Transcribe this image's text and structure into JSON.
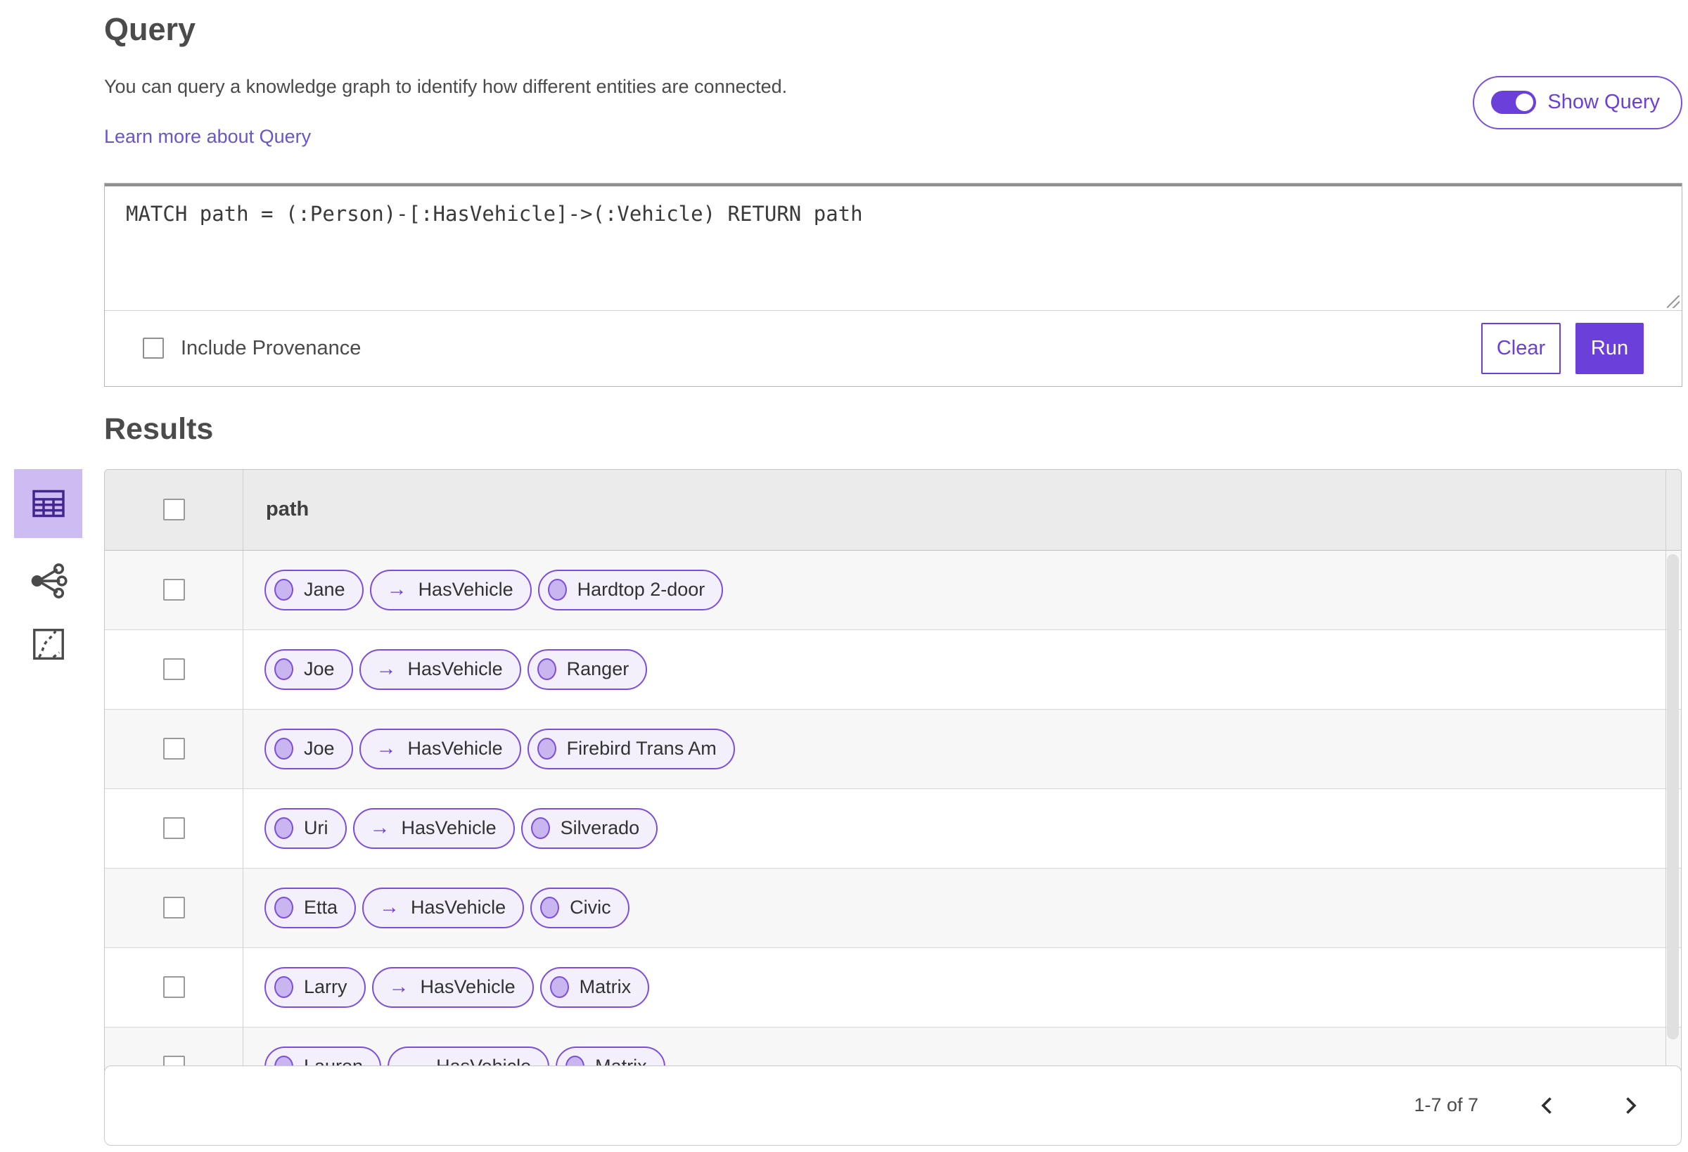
{
  "query_section": {
    "title": "Query",
    "description": "You can query a knowledge graph to identify how different entities are connected.",
    "learn_more_label": "Learn more about Query",
    "show_query": {
      "label": "Show Query",
      "state": "on"
    },
    "query_text": "MATCH path = (:Person)-[:HasVehicle]->(:Vehicle) RETURN path",
    "include_provenance": {
      "label": "Include Provenance",
      "checked": false
    },
    "clear_label": "Clear",
    "run_label": "Run"
  },
  "results_section": {
    "title": "Results",
    "views": [
      {
        "icon": "table-view-icon",
        "selected": true
      },
      {
        "icon": "link-chart-view-icon",
        "selected": false
      },
      {
        "icon": "map-view-icon",
        "selected": false
      }
    ],
    "table": {
      "columns": [
        "path"
      ],
      "select_all_checked": false,
      "rows": [
        {
          "path": [
            {
              "type": "node",
              "label": "Jane"
            },
            {
              "type": "edge",
              "label": "HasVehicle"
            },
            {
              "type": "node",
              "label": "Hardtop 2-door"
            }
          ]
        },
        {
          "path": [
            {
              "type": "node",
              "label": "Joe"
            },
            {
              "type": "edge",
              "label": "HasVehicle"
            },
            {
              "type": "node",
              "label": "Ranger"
            }
          ]
        },
        {
          "path": [
            {
              "type": "node",
              "label": "Joe"
            },
            {
              "type": "edge",
              "label": "HasVehicle"
            },
            {
              "type": "node",
              "label": "Firebird Trans Am"
            }
          ]
        },
        {
          "path": [
            {
              "type": "node",
              "label": "Uri"
            },
            {
              "type": "edge",
              "label": "HasVehicle"
            },
            {
              "type": "node",
              "label": "Silverado"
            }
          ]
        },
        {
          "path": [
            {
              "type": "node",
              "label": "Etta"
            },
            {
              "type": "edge",
              "label": "HasVehicle"
            },
            {
              "type": "node",
              "label": "Civic"
            }
          ]
        },
        {
          "path": [
            {
              "type": "node",
              "label": "Larry"
            },
            {
              "type": "edge",
              "label": "HasVehicle"
            },
            {
              "type": "node",
              "label": "Matrix"
            }
          ]
        },
        {
          "path": [
            {
              "type": "node",
              "label": "Lauren"
            },
            {
              "type": "edge",
              "label": "HasVehicle"
            },
            {
              "type": "node",
              "label": "Matrix"
            }
          ]
        }
      ]
    },
    "pagination": {
      "range_label": "1-7 of 7",
      "prev_icon": "chevron-left-icon",
      "next_icon": "chevron-right-icon"
    }
  },
  "colors": {
    "accent_purple": "#6b3fd9",
    "pill_border": "#7b4fdb",
    "pill_background": "#f3f0fb",
    "node_circle_fill": "#c9b5ef",
    "selected_tile_background": "#cdbcf2",
    "link_color": "#6a55c9",
    "header_row_background": "#ebebeb",
    "alt_row_background": "#f7f7f7"
  }
}
